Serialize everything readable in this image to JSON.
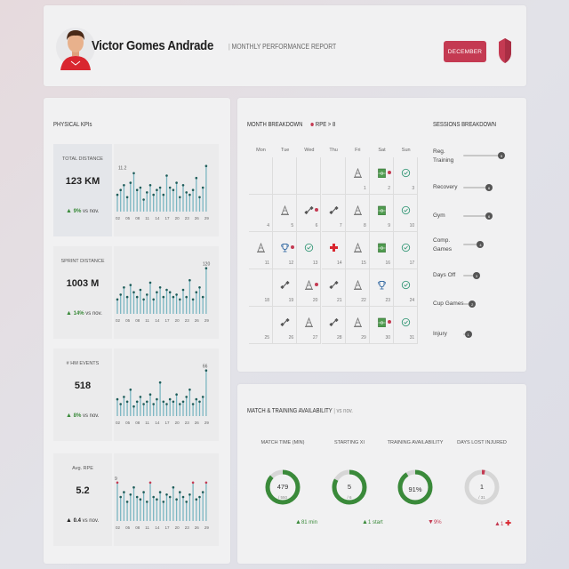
{
  "header": {
    "player_name": "Victor Gomes Andrade",
    "report_title": "MONTHLY PERFORMANCE REPORT",
    "month_button": "DECEMBER",
    "avatar_icon": "player-avatar-icon",
    "club_icon": "club-shield-icon",
    "accent_color": "#c43a52"
  },
  "kpi": {
    "title": "PHYSICAL KPIs",
    "blocks": [
      {
        "label": "TOTAL DISTANCE",
        "value": "123 KM",
        "change": "9%",
        "change_suffix": "vs nov.",
        "direction": "up",
        "max_label": "11.2",
        "bars": [
          0.35,
          0.45,
          0.55,
          0.3,
          0.6,
          0.8,
          0.45,
          0.5,
          0.25,
          0.4,
          0.55,
          0.35,
          0.45,
          0.5,
          0.35,
          0.75,
          0.5,
          0.45,
          0.6,
          0.3,
          0.55,
          0.4,
          0.35,
          0.45,
          0.7,
          0.3,
          0.5,
          0.95
        ]
      },
      {
        "label": "SPRINT DISTANCE",
        "value": "1003 M",
        "change": "14%",
        "change_suffix": "vs nov.",
        "direction": "up",
        "max_label": "120",
        "bars": [
          0.3,
          0.4,
          0.55,
          0.35,
          0.6,
          0.45,
          0.35,
          0.5,
          0.3,
          0.4,
          0.65,
          0.3,
          0.45,
          0.55,
          0.35,
          0.5,
          0.45,
          0.35,
          0.4,
          0.3,
          0.5,
          0.35,
          0.7,
          0.3,
          0.45,
          0.55,
          0.35,
          0.95
        ]
      },
      {
        "label": "# HM EVENTS",
        "value": "518",
        "change": "8%",
        "change_suffix": "vs nov.",
        "direction": "up",
        "max_label": "66",
        "bars": [
          0.35,
          0.25,
          0.4,
          0.3,
          0.55,
          0.2,
          0.3,
          0.4,
          0.25,
          0.3,
          0.45,
          0.25,
          0.35,
          0.7,
          0.3,
          0.25,
          0.35,
          0.3,
          0.45,
          0.25,
          0.3,
          0.4,
          0.55,
          0.25,
          0.35,
          0.3,
          0.4,
          0.95
        ]
      },
      {
        "label": "Avg. RPE",
        "value": "5.2",
        "change": "0.4",
        "change_suffix": "vs nov.",
        "direction": "neutral",
        "max_label": "9",
        "bars": [
          0.8,
          0.5,
          0.6,
          0.4,
          0.55,
          0.7,
          0.5,
          0.45,
          0.6,
          0.4,
          0.8,
          0.5,
          0.45,
          0.6,
          0.4,
          0.55,
          0.5,
          0.7,
          0.45,
          0.6,
          0.5,
          0.4,
          0.55,
          0.8,
          0.45,
          0.5,
          0.6,
          0.8
        ]
      }
    ],
    "x_ticks": [
      "02",
      "05",
      "08",
      "11",
      "14",
      "17",
      "20",
      "23",
      "26",
      "29"
    ]
  },
  "month": {
    "title": "MONTH BREAKDOWN",
    "legend": "RPE > 8",
    "days": [
      "Mon",
      "Tue",
      "Wed",
      "Thu",
      "Fri",
      "Sat",
      "Sun"
    ],
    "weeks": [
      [
        {
          "d": ""
        },
        {
          "d": ""
        },
        {
          "d": ""
        },
        {
          "d": ""
        },
        {
          "d": "1",
          "i": "cone"
        },
        {
          "d": "2",
          "i": "pitch",
          "r": true
        },
        {
          "d": "3",
          "i": "recovery"
        }
      ],
      [
        {
          "d": "4"
        },
        {
          "d": "5",
          "i": "cone"
        },
        {
          "d": "6",
          "i": "gym",
          "r": true
        },
        {
          "d": "7",
          "i": "gym"
        },
        {
          "d": "8",
          "i": "cone"
        },
        {
          "d": "9",
          "i": "pitch"
        },
        {
          "d": "10",
          "i": "recovery"
        }
      ],
      [
        {
          "d": "11",
          "i": "cone"
        },
        {
          "d": "12",
          "i": "cup",
          "r": true
        },
        {
          "d": "13",
          "i": "recovery"
        },
        {
          "d": "14",
          "i": "injury"
        },
        {
          "d": "15",
          "i": "cone"
        },
        {
          "d": "16",
          "i": "pitch"
        },
        {
          "d": "17",
          "i": "recovery"
        }
      ],
      [
        {
          "d": "18"
        },
        {
          "d": "19",
          "i": "gym"
        },
        {
          "d": "20",
          "i": "cone",
          "r": true
        },
        {
          "d": "21",
          "i": "gym"
        },
        {
          "d": "22",
          "i": "cone"
        },
        {
          "d": "23",
          "i": "cup"
        },
        {
          "d": "24",
          "i": "recovery"
        }
      ],
      [
        {
          "d": "25"
        },
        {
          "d": "26",
          "i": "gym"
        },
        {
          "d": "27",
          "i": "cone"
        },
        {
          "d": "28",
          "i": "gym"
        },
        {
          "d": "29",
          "i": "cone"
        },
        {
          "d": "30",
          "i": "pitch",
          "r": true
        },
        {
          "d": "31",
          "i": "recovery"
        }
      ]
    ]
  },
  "sessions": {
    "title": "SESSIONS BREAKDOWN",
    "items": [
      {
        "label": "Reg. Training",
        "value": "9",
        "level": 1.0
      },
      {
        "label": "Recovery",
        "value": "6",
        "level": 0.67
      },
      {
        "label": "Gym",
        "value": "6",
        "level": 0.67
      },
      {
        "label": "Comp. Games",
        "value": "4",
        "level": 0.44
      },
      {
        "label": "Days Off",
        "value": "3",
        "level": 0.33
      },
      {
        "label": "Cup Games",
        "value": "2",
        "level": 0.22
      },
      {
        "label": "Injury",
        "value": "1",
        "level": 0.11
      }
    ]
  },
  "availability": {
    "title": "MATCH & TRAINING AVAILABILITY",
    "subtitle": "vs nov.",
    "gauges": [
      {
        "label": "MATCH TIME (MIN)",
        "value": "479",
        "sub": "/ 550",
        "note": "81 min",
        "direction": "up",
        "fill": 0.87,
        "color": "#3a8a3a"
      },
      {
        "label": "STARTING XI",
        "value": "5",
        "sub": "/ 6",
        "note": "1 start",
        "direction": "up",
        "fill": 0.83,
        "color": "#3a8a3a"
      },
      {
        "label": "TRAINING AVAILABILITY",
        "value": "91%",
        "sub": "",
        "note": "9%",
        "direction": "down",
        "fill": 0.91,
        "color": "#3a8a3a"
      },
      {
        "label": "DAYS LOST INJURED",
        "value": "1",
        "sub": "/ 31",
        "note": "1",
        "direction": "up-bad",
        "fill": 0.03,
        "color": "#c43a52"
      }
    ]
  }
}
